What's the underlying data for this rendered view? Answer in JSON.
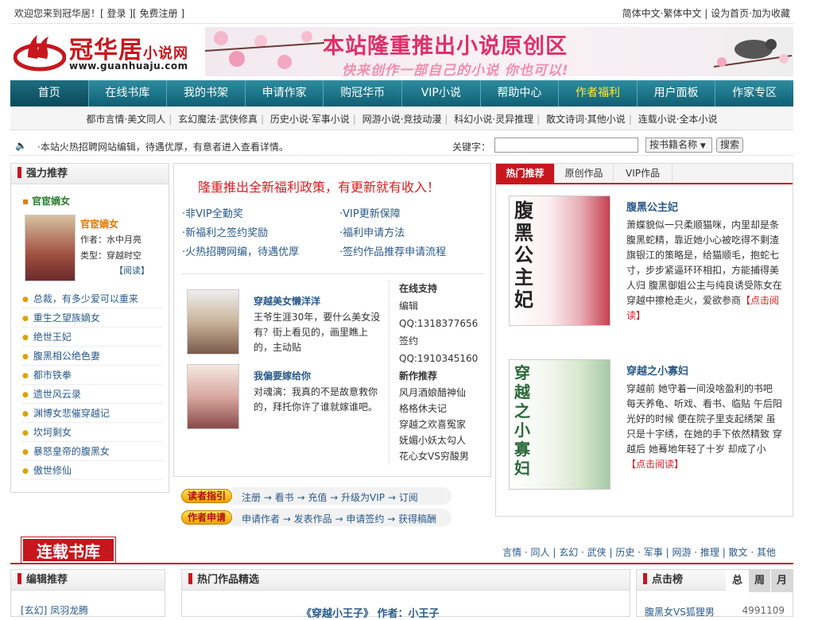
{
  "topbar": {
    "welcome": "欢迎您来到冠华居！",
    "login": "登录",
    "register": "免费注册",
    "simplified": "简体中文",
    "traditional": "繁体中文",
    "homepage": "设为首页",
    "favorite": "加为收藏"
  },
  "logo": {
    "name": "冠华居",
    "name_small": "小说网",
    "url": "www.guanhuaju.com"
  },
  "banner": {
    "line1": "本站隆重推出小说原创区",
    "line2": "快来创作一部自己的小说 你也可以!"
  },
  "nav": [
    "首页",
    "在线书库",
    "我的书架",
    "申请作家",
    "购冠华币",
    "VIP小说",
    "帮助中心",
    "作者福利",
    "用户面板",
    "作家专区"
  ],
  "subnav": [
    "都市言情·美文同人",
    "玄幻魔法·武侠修真",
    "历史小说·军事小说",
    "网游小说·竞技动漫",
    "科幻小说·灵异推理",
    "散文诗词·其他小说",
    "连载小说·全本小说"
  ],
  "notice": {
    "text": "·本站火热招聘网站编辑，待遇优厚，有意者进入查看详情。",
    "keyword_label": "关键字：",
    "search_value": "",
    "search_select": "按书籍名称",
    "search_button": "搜索"
  },
  "left": {
    "header": "强力推荐",
    "featured_title": "官宦嫡女",
    "book_title": "官宦嫡女",
    "author": "作者：水中月亮",
    "type": "类型：穿越时空",
    "read": "【阅读】",
    "list": [
      "总裁，有多少爱可以重来",
      "重生之望族嫡女",
      "绝世王妃",
      "腹黑相公绝色妻",
      "都市铁拳",
      "遗世风云录",
      "渊博女悲催穿越记",
      "坎坷剩女",
      "暴怒皇帝的腹黑女",
      "傲世修仙"
    ]
  },
  "middle": {
    "headline": "隆重推出全新福利政策，有更新就有收入！",
    "links": [
      "·非VIP全勤奖",
      "·VIP更新保障",
      "·新福利之签约奖励",
      "·福利申请方法",
      "·火热招聘网编，待遇优厚",
      "·签约作品推荐申请流程"
    ],
    "books": [
      {
        "title": "穿越美女懒洋洋",
        "desc": "王爷生涯30年，要什么美女没有？街上看见的，画里瞧上的，主动贴"
      },
      {
        "title": "我偏要嫁给你",
        "desc": "对魂漓：我真的不是故意救你的，拜托你许了谁就嫁谁吧。"
      }
    ],
    "support": {
      "header": "在线支持",
      "editor_label": "编辑",
      "editor_qq": "QQ:1318377656",
      "sign_label": "签约",
      "sign_qq": "QQ:1910345160",
      "new_header": "新作推荐",
      "new_list": [
        "风月酒娘醋神仙",
        "格格休夫记",
        "穿越之欢喜冤家",
        "妩媚小妖太勾人",
        "花心女VS穷酸男"
      ]
    }
  },
  "guides": [
    {
      "tag": "读者指引",
      "steps": "注册 → 看书 → 充值 → 升级为VIP → 订阅"
    },
    {
      "tag": "作者申请",
      "steps": "申请作者 → 发表作品 → 申请签约 → 获得稿酬"
    }
  ],
  "right": {
    "tabs": [
      "热门推荐",
      "原创作品",
      "VIP作品"
    ],
    "books": [
      {
        "title": "腹黑公主妃",
        "desc": "萧蝶貌似一只柔顺猫咪，内里却是条腹黑蛇精，靠近她小心被吃得不剩渣  旗银江的策略是，给猫顺毛，抱蛇七寸，步步紧逼环环相扣，方能捕得美人归  腹黑御姐公主与纯良诱受陈女在穿越中擦枪走火，爱欲参商",
        "more": "【点击阅读】",
        "cover_text": "腹黑公主妃"
      },
      {
        "title": "穿越之小寡妇",
        "desc": "穿越前  她守着一间没啥盈利的书吧  每天养龟、听戏、看书、临贴  午后阳光好的时候  便在院子里支起绣架  虽只是十字绣，在她的手下依然精致  穿越后  她蓦地年轻了十岁  却成了小",
        "more": "【点击阅读】",
        "cover_text": "穿越之小寡妇"
      }
    ]
  },
  "serial": {
    "logo": "连载书库",
    "cats": "言情 · 同人 | 玄幻 · 武侠 | 历史 · 军事 | 网游 · 推理 | 散文 · 其他"
  },
  "bottom": {
    "editor_header": "编辑推荐",
    "editor_first": "[玄幻] 凤羽龙腾",
    "hot_header": "热门作品精选",
    "hot_first": "《穿越小王子》  作者：小王子",
    "click_header": "点击榜",
    "click_tabs": [
      "总",
      "周",
      "月"
    ],
    "click_first_title": "腹黑女VS狐狸男",
    "click_first_count": "4991109"
  }
}
